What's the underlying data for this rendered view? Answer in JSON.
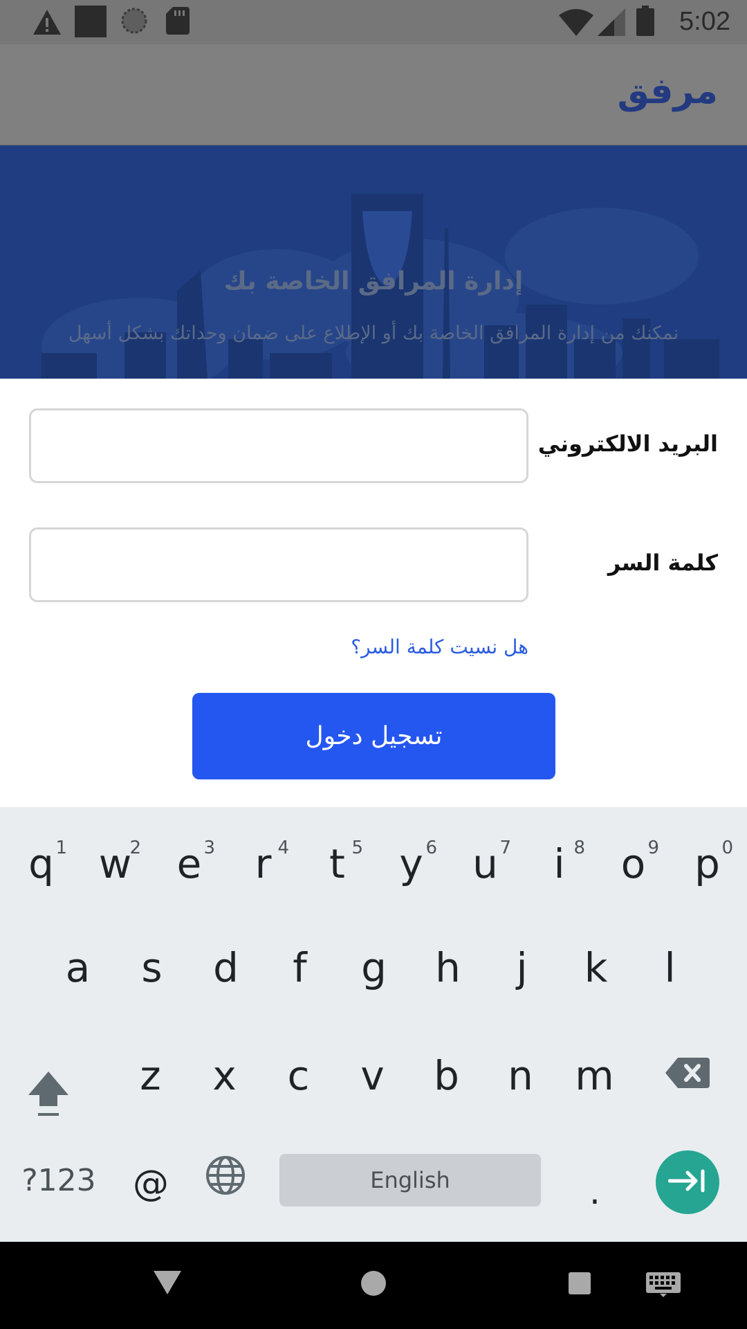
{
  "status_bar": {
    "time": "5:02",
    "left_icons": [
      "warning-icon",
      "square-icon",
      "loading-icon",
      "sd-card-icon"
    ],
    "right_icons": [
      "wifi-icon",
      "signal-icon",
      "battery-icon"
    ]
  },
  "app_bar": {
    "title": "مرفق"
  },
  "hero": {
    "title": "إدارة المرافق الخاصة بك",
    "subtitle": "نمكنك من إدارة المرافق الخاصة بك أو الإطلاع على ضمان وحداتك بشكل أسهل"
  },
  "form": {
    "email_label": "البريد الالكتروني",
    "email_value": "",
    "password_label": "كلمة السر",
    "password_value": "",
    "forgot_link": "هل نسيت كلمة السر؟",
    "login_button": "تسجيل دخول"
  },
  "keyboard": {
    "row1": [
      "q",
      "w",
      "e",
      "r",
      "t",
      "y",
      "u",
      "i",
      "o",
      "p"
    ],
    "row1_hints": [
      "1",
      "2",
      "3",
      "4",
      "5",
      "6",
      "7",
      "8",
      "9",
      "0"
    ],
    "row2": [
      "a",
      "s",
      "d",
      "f",
      "g",
      "h",
      "j",
      "k",
      "l"
    ],
    "row3": [
      "z",
      "x",
      "c",
      "v",
      "b",
      "n",
      "m"
    ],
    "symbols_key": "?123",
    "at_key": "@",
    "space_label": "English",
    "period_key": ".",
    "shift_icon": "shift-icon",
    "backspace_icon": "backspace-icon",
    "globe_icon": "globe-icon",
    "enter_icon": "next-tab-icon"
  },
  "nav_bar": {
    "icons": [
      "back-icon",
      "home-icon",
      "recents-icon",
      "keyboard-icon"
    ]
  },
  "colors": {
    "accent": "#2456f0",
    "link": "#2a5ce0",
    "enter": "#25a592",
    "hero": "#1f3d80"
  }
}
